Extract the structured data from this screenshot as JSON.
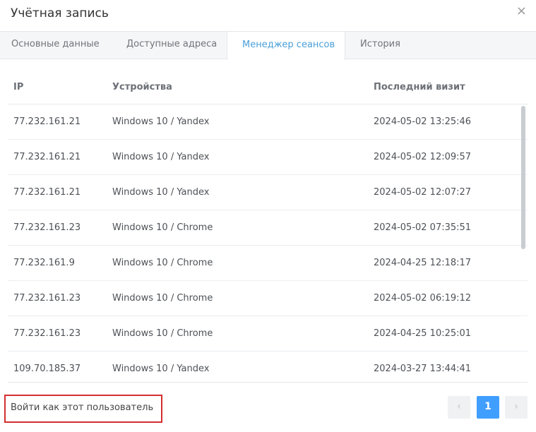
{
  "modal": {
    "title": "Учётная запись",
    "close_glyph": "×"
  },
  "tabs": [
    {
      "label": "Основные данные"
    },
    {
      "label": "Доступные адреса"
    },
    {
      "label": "Менеджер сеансов"
    },
    {
      "label": "История"
    }
  ],
  "table": {
    "headers": {
      "ip": "IP",
      "device": "Устройства",
      "last_visit": "Последний визит"
    },
    "rows": [
      {
        "ip": "77.232.161.21",
        "device": "Windows 10 / Yandex",
        "last_visit": "2024-05-02 13:25:46"
      },
      {
        "ip": "77.232.161.21",
        "device": "Windows 10 / Yandex",
        "last_visit": "2024-05-02 12:09:57"
      },
      {
        "ip": "77.232.161.21",
        "device": "Windows 10 / Yandex",
        "last_visit": "2024-05-02 12:07:27"
      },
      {
        "ip": "77.232.161.23",
        "device": "Windows 10 / Chrome",
        "last_visit": "2024-05-02 07:35:51"
      },
      {
        "ip": "77.232.161.9",
        "device": "Windows 10 / Chrome",
        "last_visit": "2024-04-25 12:18:17"
      },
      {
        "ip": "77.232.161.23",
        "device": "Windows 10 / Chrome",
        "last_visit": "2024-05-02 06:19:12"
      },
      {
        "ip": "77.232.161.23",
        "device": "Windows 10 / Chrome",
        "last_visit": "2024-04-25 10:25:01"
      },
      {
        "ip": "109.70.185.37",
        "device": "Windows 10 / Yandex",
        "last_visit": "2024-03-27 13:44:41"
      }
    ]
  },
  "footer": {
    "login_as_label": "Войти как этот пользователь",
    "pager": {
      "prev_glyph": "‹",
      "current_page": "1",
      "next_glyph": "›"
    }
  },
  "colors": {
    "accent": "#409eff",
    "active_tab": "#4a9fd8",
    "highlight_border": "#d32f2f"
  }
}
